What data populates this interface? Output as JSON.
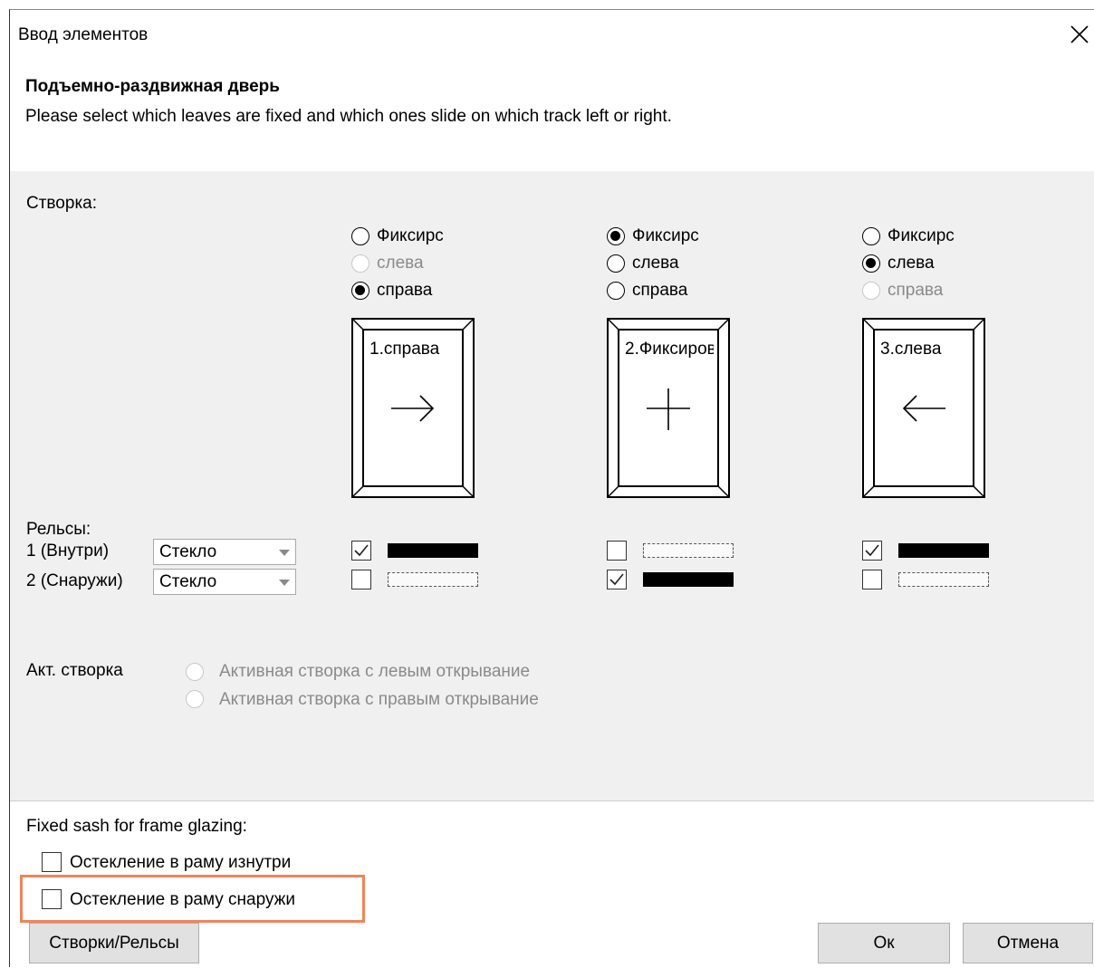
{
  "dialog": {
    "title": "Ввод элементов",
    "heading": "Подъемно-раздвижная дверь",
    "description": "Please select which leaves are fixed and which ones slide on which track left or right."
  },
  "sash_section": {
    "label": "Створка:"
  },
  "sashes": [
    {
      "options": [
        "Фиксирс",
        "слева",
        "справа"
      ],
      "selected": "справа",
      "disabled": [
        "слева"
      ],
      "leaf_label": "1.справа",
      "symbol": "arrow-right"
    },
    {
      "options": [
        "Фиксирс",
        "слева",
        "справа"
      ],
      "selected": "Фиксирс",
      "disabled": [],
      "leaf_label": "2.Фиксиров",
      "symbol": "cross"
    },
    {
      "options": [
        "Фиксирс",
        "слева",
        "справа"
      ],
      "selected": "слева",
      "disabled": [
        "справа"
      ],
      "leaf_label": "3.слева",
      "symbol": "arrow-left"
    }
  ],
  "rails": {
    "label": "Рельсы:",
    "rows": [
      {
        "label": "1 (Внутри)",
        "value": "Стекло"
      },
      {
        "label": "2 (Снаружи)",
        "value": "Стекло"
      }
    ],
    "checks": [
      {
        "rail1": true,
        "rail2": false
      },
      {
        "rail1": false,
        "rail2": true
      },
      {
        "rail1": true,
        "rail2": false
      }
    ]
  },
  "active_sash": {
    "label": "Акт. створка",
    "options": [
      "Активная створка с левым открывание",
      "Активная створка с правым открывание"
    ]
  },
  "fixed_glazing": {
    "label": "Fixed sash for frame glazing:",
    "options": [
      {
        "label": "Остекление в раму изнутри",
        "checked": false
      },
      {
        "label": "Остекление в раму снаружи",
        "checked": false,
        "highlighted": true
      }
    ]
  },
  "buttons": {
    "sashes_rails": "Створки/Рельсы",
    "ok": "Ок",
    "cancel": "Отмена"
  },
  "colors": {
    "highlight": "#f0845a",
    "button_bg": "#e1e1e1",
    "main_bg": "#f0f0f0"
  },
  "icons": {
    "close": "close-icon"
  }
}
